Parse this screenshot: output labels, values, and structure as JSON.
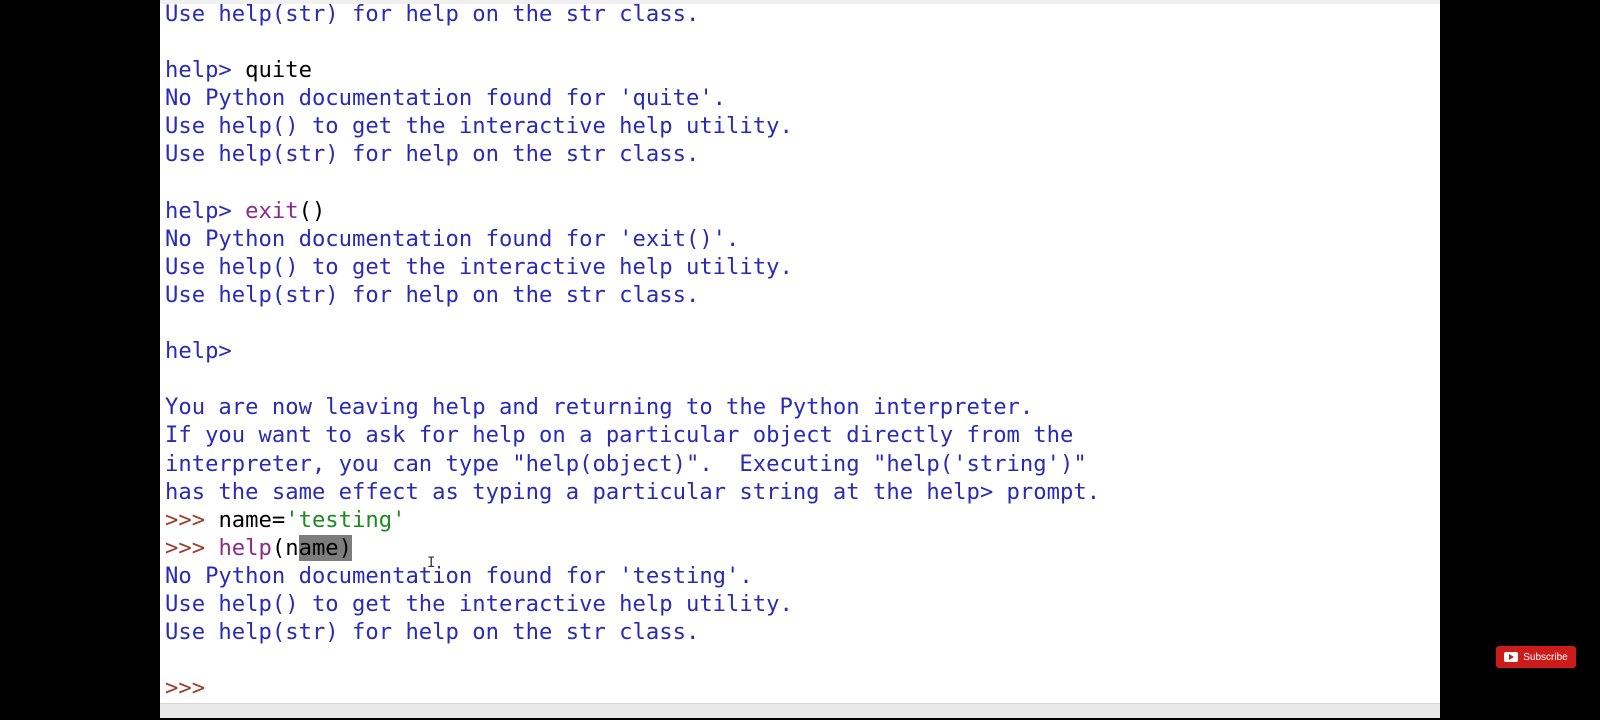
{
  "console": {
    "lines": [
      {
        "segments": [
          {
            "c": "out",
            "t": "Use help(str) for help on the str class."
          }
        ]
      },
      {
        "segments": []
      },
      {
        "segments": [
          {
            "c": "out",
            "t": "help> "
          },
          {
            "c": "plain",
            "t": "quite"
          }
        ]
      },
      {
        "segments": [
          {
            "c": "out",
            "t": "No Python documentation found for 'quite'."
          }
        ]
      },
      {
        "segments": [
          {
            "c": "out",
            "t": "Use help() to get the interactive help utility."
          }
        ]
      },
      {
        "segments": [
          {
            "c": "out",
            "t": "Use help(str) for help on the str class."
          }
        ]
      },
      {
        "segments": []
      },
      {
        "segments": [
          {
            "c": "out",
            "t": "help> "
          },
          {
            "c": "builtin",
            "t": "exit"
          },
          {
            "c": "plain",
            "t": "()"
          }
        ]
      },
      {
        "segments": [
          {
            "c": "out",
            "t": "No Python documentation found for 'exit()'."
          }
        ]
      },
      {
        "segments": [
          {
            "c": "out",
            "t": "Use help() to get the interactive help utility."
          }
        ]
      },
      {
        "segments": [
          {
            "c": "out",
            "t": "Use help(str) for help on the str class."
          }
        ]
      },
      {
        "segments": []
      },
      {
        "segments": [
          {
            "c": "out",
            "t": "help>"
          }
        ]
      },
      {
        "segments": []
      },
      {
        "segments": [
          {
            "c": "out",
            "t": "You are now leaving help and returning to the Python interpreter."
          }
        ]
      },
      {
        "segments": [
          {
            "c": "out",
            "t": "If you want to ask for help on a particular object directly from the"
          }
        ]
      },
      {
        "segments": [
          {
            "c": "out",
            "t": "interpreter, you can type \"help(object)\".  Executing \"help('string')\""
          }
        ]
      },
      {
        "segments": [
          {
            "c": "out",
            "t": "has the same effect as typing a particular string at the help> prompt."
          }
        ]
      },
      {
        "segments": [
          {
            "c": "prompt",
            "t": ">>> "
          },
          {
            "c": "plain",
            "t": "name="
          },
          {
            "c": "str",
            "t": "'testing'"
          }
        ]
      },
      {
        "segments": [
          {
            "c": "prompt",
            "t": ">>> "
          },
          {
            "c": "builtin",
            "t": "help"
          },
          {
            "c": "plain",
            "t": "(n"
          },
          {
            "c": "sel",
            "t": "ame)"
          }
        ]
      },
      {
        "segments": [
          {
            "c": "out",
            "t": "No Python documentation found for 'testing'."
          }
        ]
      },
      {
        "segments": [
          {
            "c": "out",
            "t": "Use help() to get the interactive help utility."
          }
        ]
      },
      {
        "segments": [
          {
            "c": "out",
            "t": "Use help(str) for help on the str class."
          }
        ]
      },
      {
        "segments": []
      },
      {
        "segments": [
          {
            "c": "prompt",
            "t": ">>>"
          }
        ]
      }
    ]
  },
  "overlay": {
    "subscribe_label": "Subscribe"
  },
  "colors": {
    "output_blue": "#2a2ab8",
    "prompt_red": "#9b3a2a",
    "builtin_purple": "#8d2a8d",
    "string_green": "#1e8a1e",
    "selection_gray": "#7d7d7d",
    "subscribe_red": "#cc1b1b"
  },
  "icons": {
    "subscribe": "youtube-play-icon",
    "cursor": "text-cursor-icon"
  }
}
